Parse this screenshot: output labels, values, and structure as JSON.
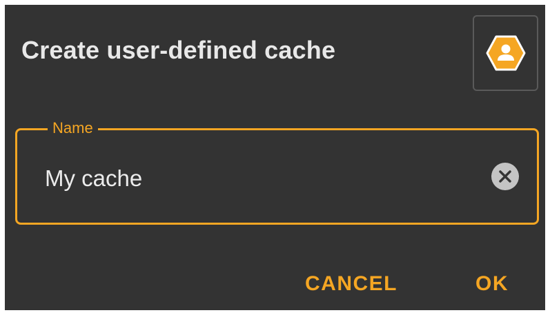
{
  "dialog": {
    "title": "Create user-defined cache",
    "type_button_icon": "user-cache-hexagon-icon"
  },
  "name_field": {
    "label": "Name",
    "value": "My cache",
    "clear_icon": "clear-circle-x-icon"
  },
  "actions": {
    "cancel_label": "CANCEL",
    "ok_label": "OK"
  },
  "colors": {
    "accent": "#f5a623",
    "dialog_background": "#333333",
    "text_primary": "#e8e8e8",
    "clear_icon": "#c4c4c4"
  }
}
